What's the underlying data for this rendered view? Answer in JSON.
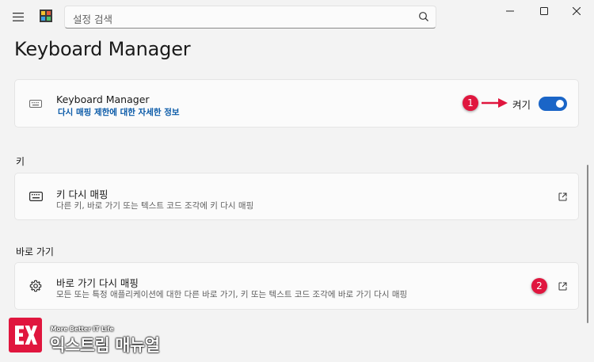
{
  "search": {
    "placeholder": "설정 검색"
  },
  "page": {
    "title": "Keyboard Manager"
  },
  "main_card": {
    "title": "Keyboard Manager",
    "link": "다시 매핑 제한에 대한 자세한 정보",
    "toggle_label": "켜기",
    "toggle_on": true
  },
  "sections": [
    {
      "label": "키",
      "item": {
        "title": "키 다시 매핑",
        "desc": "다른 키, 바로 가기 또는 텍스트 코드 조각에 키 다시 매핑"
      }
    },
    {
      "label": "바로 가기",
      "item": {
        "title": "바로 가기 다시 매핑",
        "desc": "모든 또는 특정 애플리케이션에 대한 다른 바로 가기, 키 또는 텍스트 코드 조각에 바로 가기 다시 매핑"
      }
    }
  ],
  "annotations": {
    "badge1": "1",
    "badge2": "2"
  },
  "watermark": {
    "tagline": "More Better IT Life",
    "name": "익스트림 매뉴얼"
  },
  "colors": {
    "accent": "#1a65c7",
    "badge": "#e0163e",
    "link": "#0a5aa8"
  }
}
